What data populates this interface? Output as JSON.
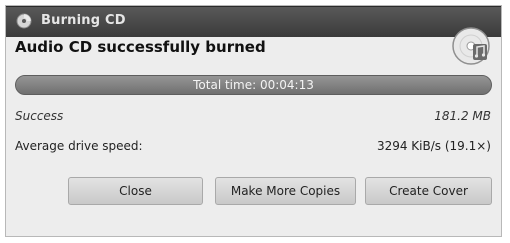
{
  "window": {
    "title": "Burning CD"
  },
  "icons": {
    "title_icon": "disc-burner-icon",
    "status_icon": "audio-cd-icon"
  },
  "status": {
    "heading": "Audio CD successfully burned",
    "progress_text": "Total time: 00:04:13",
    "progress_fraction": 1.0
  },
  "details": {
    "result_label": "Success",
    "result_value": "181.2 MB",
    "speed_label": "Average drive speed:",
    "speed_value": "3294 KiB/s (19.1×)"
  },
  "buttons": {
    "close": "Close",
    "copies": "Make More Copies",
    "cover": "Create Cover"
  },
  "colors": {
    "titlebar": "#4a4a4a",
    "progress": "#7a7a7a",
    "window_bg": "#ededed"
  }
}
